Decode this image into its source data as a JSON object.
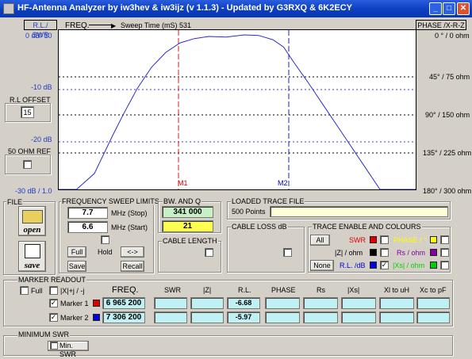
{
  "window": {
    "title": "HF-Antenna Analyzer by iw3hev & iw3ijz  (v 1.1.3) - Updated by G3RXQ & 6K2ECY"
  },
  "header": {
    "left_mode": "R.L./ SWR",
    "freq_label": "FREQ.",
    "sweep_label": "Sweep Time (mS) 531",
    "right_mode": "PHASE /X-R-Z"
  },
  "plot": {
    "left_axis": [
      "0 dB/ 10",
      "-10 dB",
      "-20 dB",
      "-30 dB / 1.0"
    ],
    "right_axis": [
      "0 ° / 0 ohm",
      "45° / 75 ohm",
      "90° / 150 ohm",
      "135° / 225 ohm",
      "180° / 300 ohm"
    ],
    "markers": [
      "M1",
      "M2"
    ],
    "trace": {
      "x": [
        0,
        0.05,
        0.1,
        0.15,
        0.18,
        0.22,
        0.26,
        0.3,
        0.34,
        0.38,
        0.42,
        0.47,
        0.52,
        0.56,
        0.6,
        0.63,
        0.66,
        0.7,
        0.74,
        0.78,
        0.82,
        0.86,
        0.9,
        0.95,
        1.0
      ],
      "db": [
        -40,
        -34,
        -27,
        -20,
        -16,
        -11,
        -7,
        -4.2,
        -2.4,
        -1.6,
        -1.2,
        -1.3,
        -0.9,
        -1.0,
        -1.8,
        -3.2,
        -6.2,
        -10,
        -14,
        -18,
        -22,
        -26,
        -30,
        -35,
        -40
      ]
    }
  },
  "left_panel": {
    "rl_offset_label": "R.L OFFSET",
    "rl_offset_value": "15",
    "ohm_ref_label": "50 OHM REF"
  },
  "file": {
    "label": "FILE",
    "open_label": "open",
    "save_label": "save"
  },
  "sweep": {
    "title": "FREQUENCY SWEEP LIMITS",
    "stop_value": "7.7",
    "stop_unit": "MHz (Stop)",
    "start_value": "6.6",
    "start_unit": "MHz (Start)",
    "full_label": "Full",
    "hold_label": "Hold",
    "swap_label": "<->",
    "save_label": "Save",
    "recall_label": "Recall"
  },
  "bw": {
    "title": "BW. AND  Q",
    "bw_value": "341 000",
    "q_value": "21",
    "cable_length_label": "CABLE LENGTH"
  },
  "loaded": {
    "title": "LOADED TRACE FILE",
    "points": "500  Points",
    "file_value": ""
  },
  "cable_loss": {
    "title": "CABLE LOSS dB"
  },
  "trace_enable": {
    "title": "TRACE ENABLE AND COLOURS",
    "all_label": "All",
    "none_label": "None",
    "items": [
      {
        "label": "SWR",
        "color": "#e00000",
        "checked": ""
      },
      {
        "label": "|Z| / ohm",
        "color": "#000000",
        "checked": ""
      },
      {
        "label": "R.L. /dB",
        "color": "#0000e0",
        "checked": "✓"
      },
      {
        "label": "PHASE / °",
        "color": "#ffff00",
        "checked": ""
      },
      {
        "label": "Rs / ohm",
        "color": "#8000a0",
        "checked": ""
      },
      {
        "label": "|Xs| / ohm",
        "color": "#00d000",
        "checked": ""
      }
    ]
  },
  "marker_readout": {
    "title": "MARKER READOUT",
    "full_label": "Full",
    "sign_label": "|X|+j / -j",
    "columns": [
      "FREQ.",
      "SWR",
      "|Z|",
      "R.L.",
      "PHASE",
      "Rs",
      "|Xs|",
      "Xl to uH",
      "Xc to pF"
    ],
    "rows": [
      {
        "label": "Marker 1",
        "color": "#e00000",
        "freq": "6 965 200",
        "rl": "-6.68"
      },
      {
        "label": "Marker 2",
        "color": "#0000e0",
        "freq": "7 306 200",
        "rl": "-5.97"
      }
    ]
  },
  "minimum_swr": {
    "title": "MINIMUM SWR",
    "button_label": "Min. SWR"
  }
}
